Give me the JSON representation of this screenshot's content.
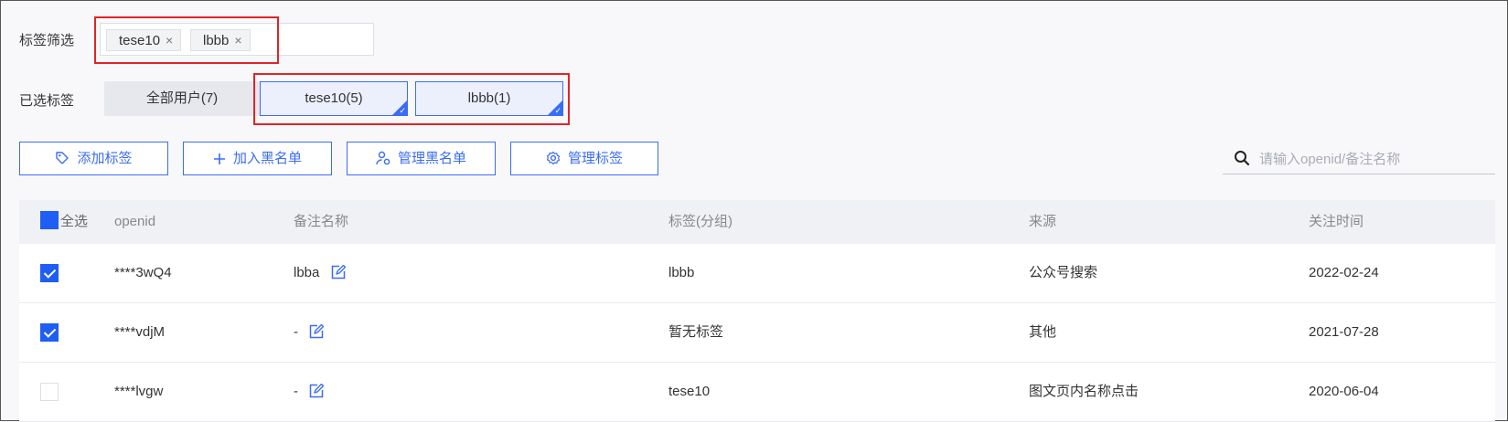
{
  "filter": {
    "label": "标签筛选",
    "chips": [
      {
        "text": "tese10",
        "remove": "×"
      },
      {
        "text": "lbbb",
        "remove": "×"
      }
    ]
  },
  "selected": {
    "label": "已选标签",
    "all": "全部用户(7)",
    "tags": [
      "tese10(5)",
      "lbbb(1)"
    ]
  },
  "toolbar": {
    "add_tag": "添加标签",
    "add_blacklist": "加入黑名单",
    "manage_blacklist": "管理黑名单",
    "manage_tags": "管理标签"
  },
  "search": {
    "placeholder": "请输入openid/备注名称"
  },
  "accent_color": "#3b6cf5",
  "table": {
    "headers": {
      "select_all": "全选",
      "openid": "openid",
      "remark": "备注名称",
      "tags": "标签(分组)",
      "source": "来源",
      "follow_time": "关注时间"
    },
    "rows": [
      {
        "checked": true,
        "openid": "****3wQ4",
        "remark": "lbba",
        "tags": "lbbb",
        "source": "公众号搜索",
        "time": "2022-02-24"
      },
      {
        "checked": true,
        "openid": "****vdjM",
        "remark": "-",
        "tags": "暂无标签",
        "source": "其他",
        "time": "2021-07-28"
      },
      {
        "checked": false,
        "openid": "****lvgw",
        "remark": "-",
        "tags": "tese10",
        "source": "图文页内名称点击",
        "time": "2020-06-04"
      }
    ]
  }
}
